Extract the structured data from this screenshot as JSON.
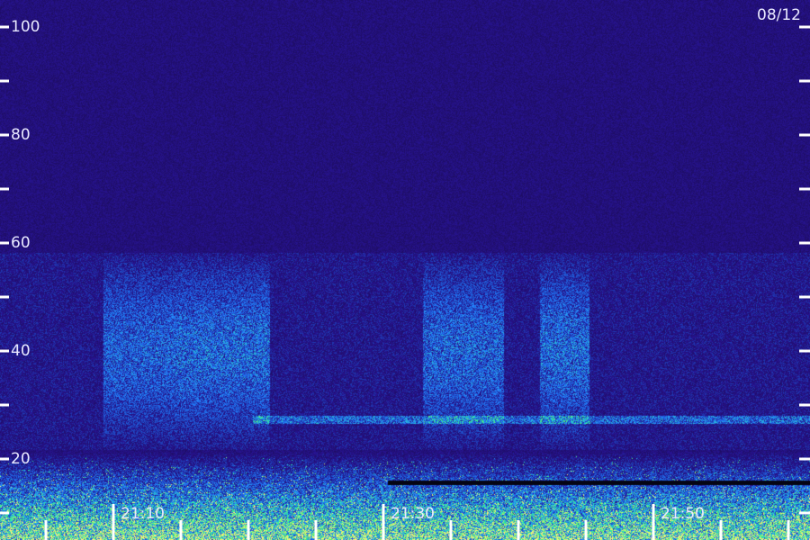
{
  "date_label": "08/12",
  "chart_data": {
    "type": "heatmap",
    "title": "",
    "xlabel": "",
    "ylabel": "",
    "ylim": [
      10,
      100
    ],
    "y_ticks": [
      {
        "value": 100,
        "label": "100"
      },
      {
        "value": 90,
        "label": ""
      },
      {
        "value": 80,
        "label": "80"
      },
      {
        "value": 70,
        "label": ""
      },
      {
        "value": 60,
        "label": "60"
      },
      {
        "value": 50,
        "label": ""
      },
      {
        "value": 40,
        "label": "40"
      },
      {
        "value": 30,
        "label": ""
      },
      {
        "value": 20,
        "label": "20"
      },
      {
        "value": 10,
        "label": ""
      }
    ],
    "x_ticks": [
      {
        "label": "21:10",
        "major": true
      },
      {
        "label": "21:30",
        "major": true
      },
      {
        "label": "21:50",
        "major": true
      }
    ],
    "x_range_minutes": [
      21.6,
      81.6
    ],
    "x_tick_minutes": [
      30,
      50,
      70
    ],
    "x_minor_every_minutes": 5,
    "colors": {
      "background": "#1a0a5a",
      "low": "#2010a0",
      "mid": "#2050ff",
      "high": "#30f0c0",
      "peak": "#f0f080"
    }
  }
}
